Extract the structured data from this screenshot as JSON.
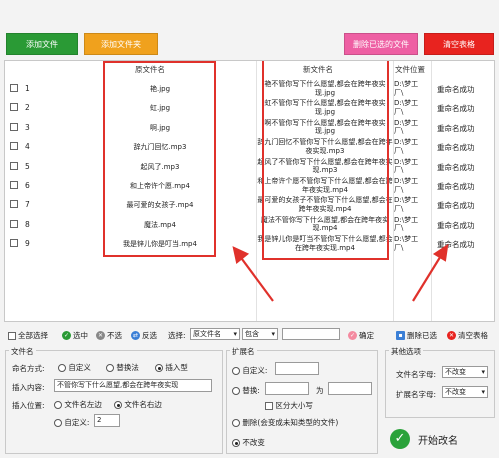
{
  "toolbar": {
    "add_file": "添加文件",
    "add_folder": "添加文件夹",
    "delete_selected": "删除已选的文件",
    "clear_table": "清空表格"
  },
  "table": {
    "headers": {
      "original": "原文件名",
      "new_name": "新文件名",
      "location": "文件位置"
    },
    "rows": [
      {
        "num": "1",
        "original": "艳.jpg",
        "new_name": "艳不管你写下什么愿望,都会在跨年夜实现.jpg",
        "location": "D:\\梦工厂\\",
        "status": "重命名成功"
      },
      {
        "num": "2",
        "original": "虹.jpg",
        "new_name": "虹不管你写下什么愿望,都会在跨年夜实现.jpg",
        "location": "D:\\梦工厂\\",
        "status": "重命名成功"
      },
      {
        "num": "3",
        "original": "啊.jpg",
        "new_name": "啊不管你写下什么愿望,都会在跨年夜实现.jpg",
        "location": "D:\\梦工厂\\",
        "status": "重命名成功"
      },
      {
        "num": "4",
        "original": "辞九门回忆.mp3",
        "new_name": "辞九门回忆不管你写下什么愿望,都会在跨年夜实现.mp3",
        "location": "D:\\梦工厂\\",
        "status": "重命名成功"
      },
      {
        "num": "5",
        "original": "起风了.mp3",
        "new_name": "起风了不管你写下什么愿望,都会在跨年夜实现.mp3",
        "location": "D:\\梦工厂\\",
        "status": "重命名成功"
      },
      {
        "num": "6",
        "original": "和上帝许个愿.mp4",
        "new_name": "和上帝许个愿不管你写下什么愿望,都会在跨年夜实现.mp4",
        "location": "D:\\梦工厂\\",
        "status": "重命名成功"
      },
      {
        "num": "7",
        "original": "最可爱的女孩子.mp4",
        "new_name": "最可爱的女孩子不管你写下什么愿望,都会在跨年夜实现.mp4",
        "location": "D:\\梦工厂\\",
        "status": "重命名成功"
      },
      {
        "num": "8",
        "original": "魔法.mp4",
        "new_name": "魔法不管你写下什么愿望,都会在跨年夜实现.mp4",
        "location": "D:\\梦工厂\\",
        "status": "重命名成功"
      },
      {
        "num": "9",
        "original": "我是锌儿你是叮当.mp4",
        "new_name": "我是锌儿你是叮当不管你写下什么愿望,都会在跨年夜实现.mp4",
        "location": "D:\\梦工厂\\",
        "status": "重命名成功"
      }
    ]
  },
  "selection_bar": {
    "select_all": "全部选择",
    "select": "选中",
    "deselect": "不选",
    "invert": "反选",
    "select_label": "选择:",
    "select_value": "原文件名",
    "match_value": "包含",
    "confirm": "确定",
    "delete_selected": "删除已选",
    "clear_table": "清空表格"
  },
  "filename_panel": {
    "title": "文件名",
    "naming_label": "命名方式:",
    "opt_custom": "自定义",
    "opt_replace": "替换法",
    "opt_insert": "插入型",
    "insert_label": "插入内容:",
    "insert_value": "不管你写下什么愿望,都会在跨年夜实现",
    "position_label": "插入位置:",
    "pos_left": "文件名左边",
    "pos_right": "文件名右边",
    "pos_custom": "自定义:",
    "pos_custom_value": "2"
  },
  "ext_panel": {
    "title": "扩展名",
    "opt_custom": "自定义:",
    "opt_replace": "替换:",
    "replace_to": "为",
    "case_sensitive": "区分大小写",
    "opt_delete": "删除(会变成未知类型的文件)",
    "opt_nochange": "不改变"
  },
  "other_panel": {
    "title": "其他选项",
    "filename_case_label": "文件名字母:",
    "filename_case_value": "不改变",
    "ext_case_label": "扩展名字母:",
    "ext_case_value": "不改变",
    "start": "开始改名"
  }
}
